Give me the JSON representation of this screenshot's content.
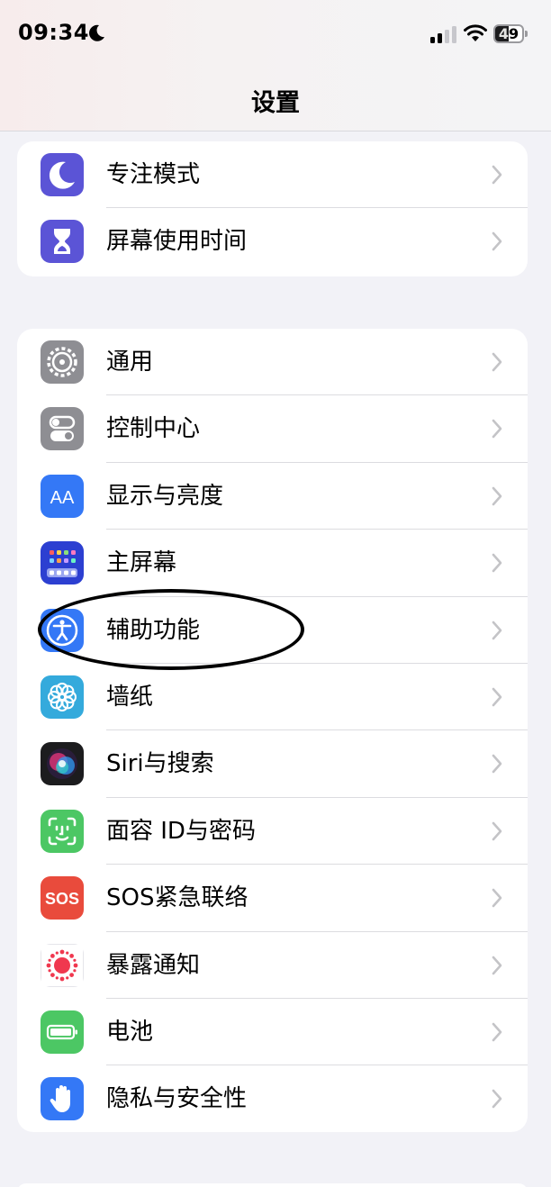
{
  "status_bar": {
    "time": "09:34",
    "battery": "49",
    "battery_level": 49
  },
  "nav": {
    "title": "设置"
  },
  "groups": [
    {
      "items": [
        {
          "label": "专注模式",
          "icon": "moon-icon",
          "color": "#5b54d6"
        },
        {
          "label": "屏幕使用时间",
          "icon": "hourglass-icon",
          "color": "#5b54d6"
        }
      ]
    },
    {
      "items": [
        {
          "label": "通用",
          "icon": "gear-icon",
          "color": "#8e8e93"
        },
        {
          "label": "控制中心",
          "icon": "toggles-icon",
          "color": "#8e8e93"
        },
        {
          "label": "显示与亮度",
          "icon": "text-size-icon",
          "color": "#3478f6"
        },
        {
          "label": "主屏幕",
          "icon": "home-grid-icon",
          "color": "#2c3fd1"
        },
        {
          "label": "辅助功能",
          "icon": "accessibility-icon",
          "color": "#3478f6"
        },
        {
          "label": "墙纸",
          "icon": "flower-icon",
          "color": "#34aadc"
        },
        {
          "label": "Siri与搜索",
          "icon": "siri-icon",
          "color": "#1c1c1e"
        },
        {
          "label": "面容 ID与密码",
          "icon": "face-id-icon",
          "color": "#4cc764"
        },
        {
          "label": "SOS紧急联络",
          "icon": "sos-icon",
          "color": "#e94b3c",
          "icon_text": "SOS"
        },
        {
          "label": "暴露通知",
          "icon": "exposure-icon",
          "color": "#ffffff"
        },
        {
          "label": "电池",
          "icon": "battery-icon",
          "color": "#4cc764"
        },
        {
          "label": "隐私与安全性",
          "icon": "hand-icon",
          "color": "#3478f6"
        }
      ]
    }
  ]
}
